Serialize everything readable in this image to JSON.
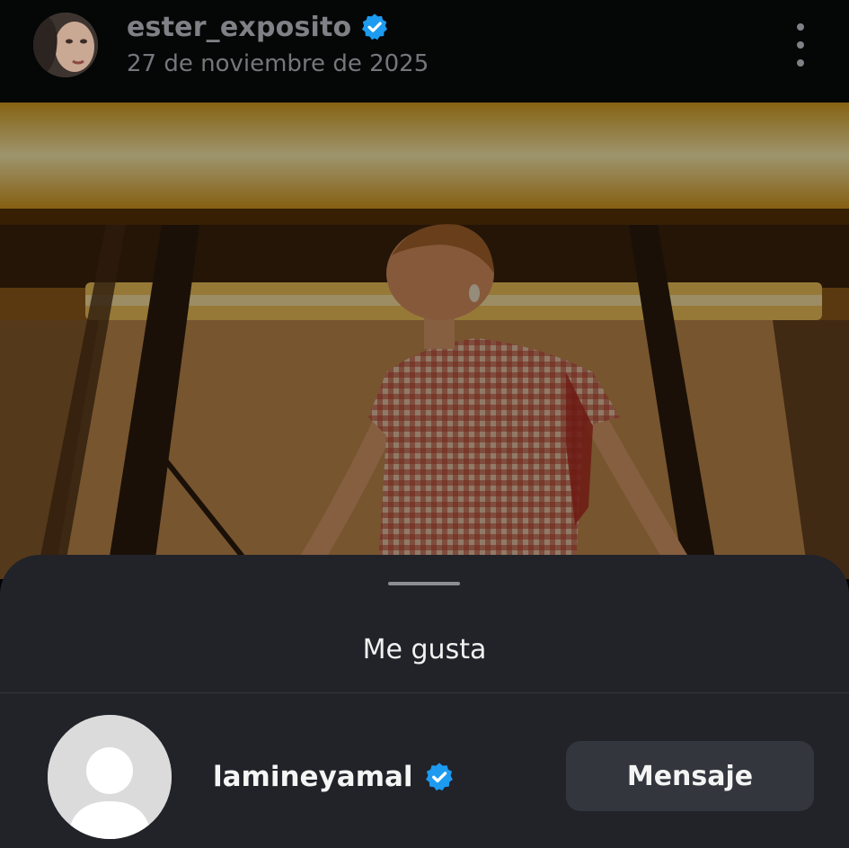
{
  "post": {
    "username": "ester_exposito",
    "date": "27 de noviembre de 2025",
    "verified": true,
    "more_icon": "more-vertical-icon",
    "image": "photo of a woman in a red gingham dress in a warmly lit elevator"
  },
  "likes_sheet": {
    "title": "Me gusta",
    "users": [
      {
        "username": "lamineyamal",
        "verified": true,
        "avatar": "default-avatar-icon",
        "action_label": "Mensaje"
      }
    ]
  },
  "colors": {
    "verified_badge": "#1d9bf0",
    "sheet_background": "#212329",
    "button_background": "#33363d"
  }
}
